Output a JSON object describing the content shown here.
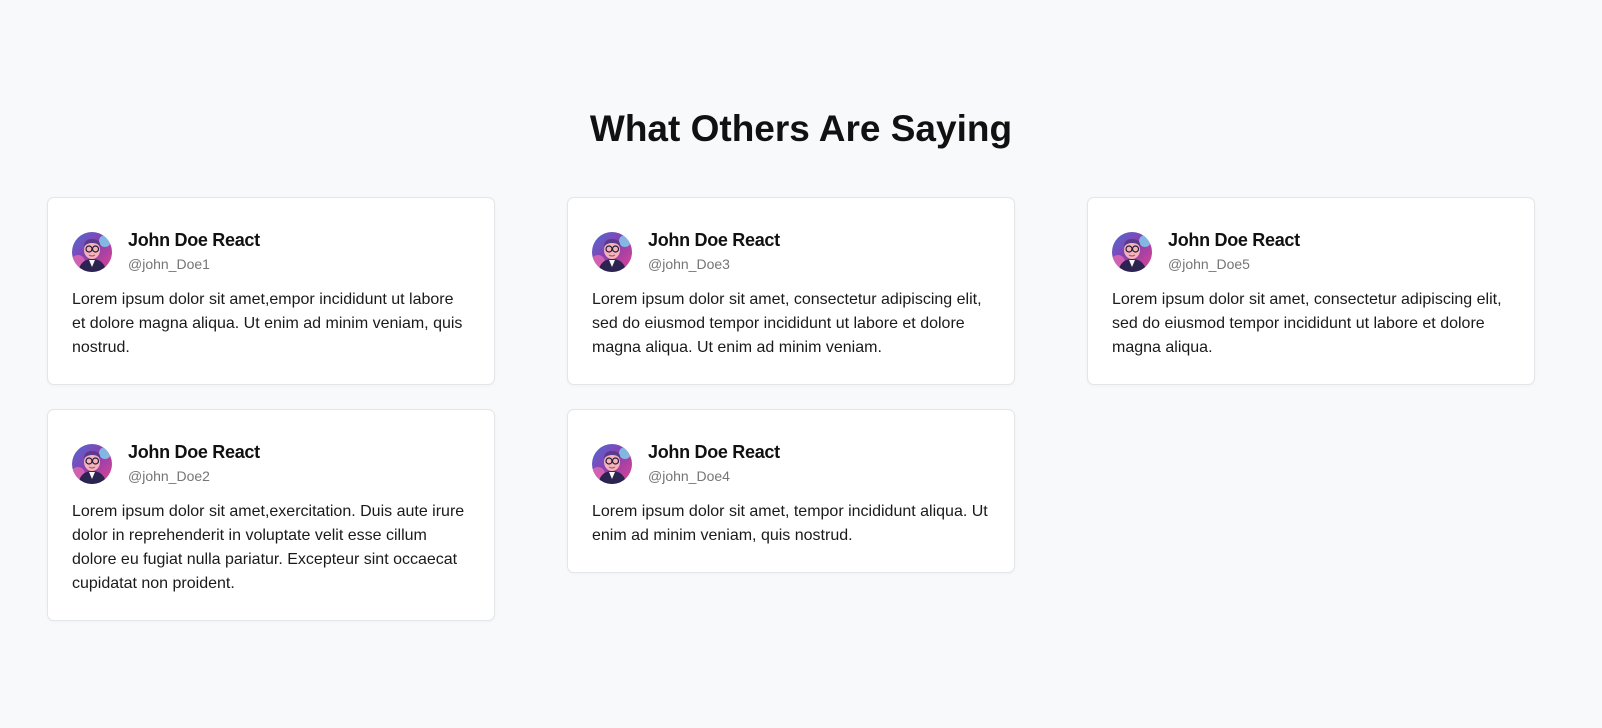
{
  "section": {
    "title": "What Others Are Saying"
  },
  "colors": {
    "background": "#f8f9fb",
    "card_background": "#ffffff",
    "card_border": "#e3e5e8",
    "handle_text": "#757575"
  },
  "testimonials": [
    {
      "name": "John Doe React",
      "handle": "@john_Doe1",
      "text": "Lorem ipsum dolor sit amet,empor incididunt ut labore et dolore magna aliqua. Ut enim ad minim veniam, quis nostrud.",
      "avatar_icon": "cartoon-avatar-icon"
    },
    {
      "name": "John Doe React",
      "handle": "@john_Doe2",
      "text": "Lorem ipsum dolor sit amet,exercitation. Duis aute irure dolor in reprehenderit in voluptate velit esse cillum dolore eu fugiat nulla pariatur. Excepteur sint occaecat cupidatat non proident.",
      "avatar_icon": "cartoon-avatar-icon"
    },
    {
      "name": "John Doe React",
      "handle": "@john_Doe3",
      "text": "Lorem ipsum dolor sit amet, consectetur adipiscing elit, sed do eiusmod tempor incididunt ut labore et dolore magna aliqua. Ut enim ad minim veniam.",
      "avatar_icon": "cartoon-avatar-icon"
    },
    {
      "name": "John Doe React",
      "handle": "@john_Doe4",
      "text": "Lorem ipsum dolor sit amet, tempor incididunt aliqua. Ut enim ad minim veniam, quis nostrud.",
      "avatar_icon": "cartoon-avatar-icon"
    },
    {
      "name": "John Doe React",
      "handle": "@john_Doe5",
      "text": "Lorem ipsum dolor sit amet, consectetur adipiscing elit, sed do eiusmod tempor incididunt ut labore et dolore magna aliqua.",
      "avatar_icon": "cartoon-avatar-icon"
    }
  ]
}
